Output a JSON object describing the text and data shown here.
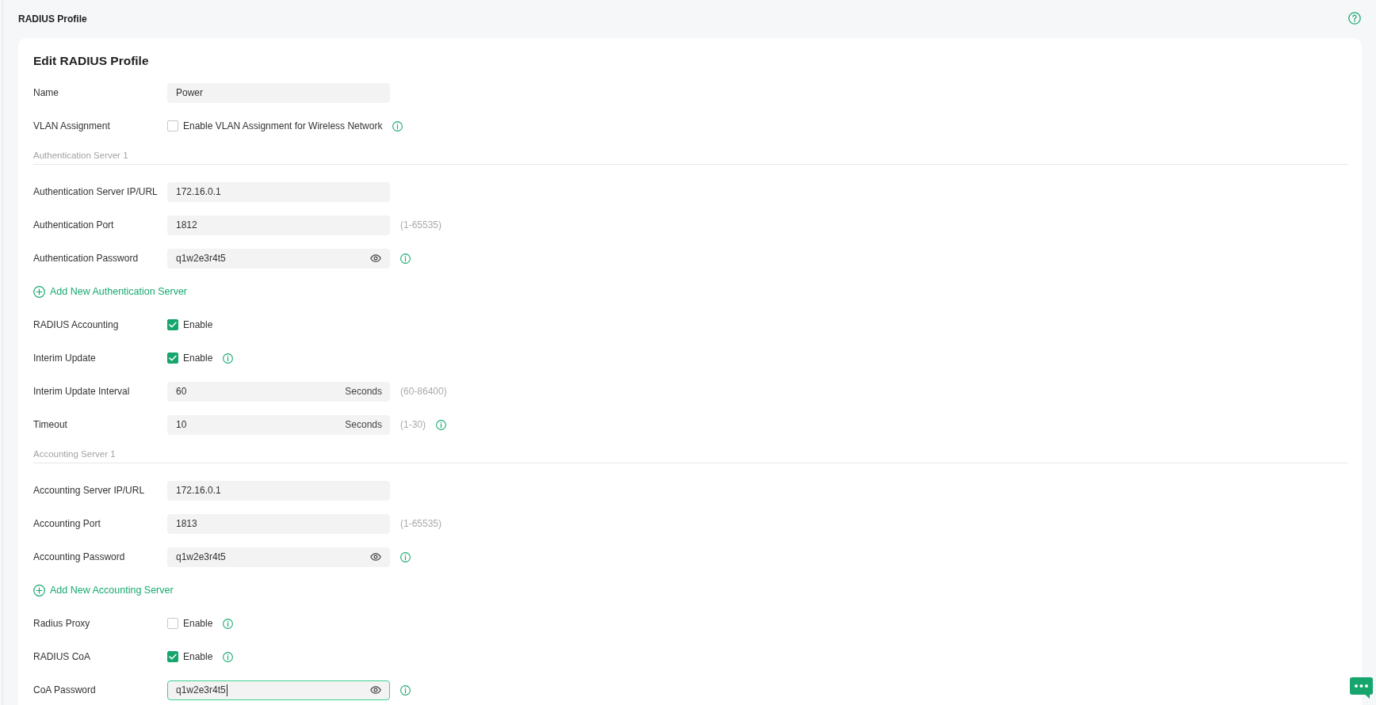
{
  "header": {
    "title": "RADIUS Profile"
  },
  "form": {
    "title": "Edit RADIUS Profile",
    "items": [
      {
        "kind": "field",
        "label": "Name",
        "value": "Power",
        "info": false,
        "focused": false
      },
      {
        "kind": "checkbox",
        "label": "VLAN Assignment",
        "text": "Enable VLAN Assignment for Wireless Network",
        "checked": false,
        "info": true
      },
      {
        "kind": "section",
        "title": "Authentication Server 1"
      },
      {
        "kind": "field",
        "label": "Authentication Server IP/URL",
        "value": "172.16.0.1",
        "info": false,
        "focused": false
      },
      {
        "kind": "field",
        "label": "Authentication Port",
        "value": "1812",
        "hint": "(1-65535)",
        "info": false,
        "focused": false
      },
      {
        "kind": "password",
        "label": "Authentication Password",
        "value": "q1w2e3r4t5",
        "info": true,
        "focused": false
      },
      {
        "kind": "add",
        "text": "Add New Authentication Server"
      },
      {
        "kind": "checkbox",
        "label": "RADIUS Accounting",
        "text": "Enable",
        "checked": true,
        "info": false
      },
      {
        "kind": "checkbox",
        "label": "Interim Update",
        "text": "Enable",
        "checked": true,
        "info": true
      },
      {
        "kind": "field",
        "label": "Interim Update Interval",
        "value": "60",
        "unit": "Seconds",
        "hint": "(60-86400)",
        "info": false,
        "focused": false
      },
      {
        "kind": "field",
        "label": "Timeout",
        "value": "10",
        "unit": "Seconds",
        "hint": "(1-30)",
        "info": true,
        "focused": false
      },
      {
        "kind": "section",
        "title": "Accounting Server 1"
      },
      {
        "kind": "field",
        "label": "Accounting Server IP/URL",
        "value": "172.16.0.1",
        "info": false,
        "focused": false
      },
      {
        "kind": "field",
        "label": "Accounting Port",
        "value": "1813",
        "hint": "(1-65535)",
        "info": false,
        "focused": false
      },
      {
        "kind": "password",
        "label": "Accounting Password",
        "value": "q1w2e3r4t5",
        "info": true,
        "focused": false
      },
      {
        "kind": "add",
        "text": "Add New Accounting Server"
      },
      {
        "kind": "checkbox",
        "label": "Radius Proxy",
        "text": "Enable",
        "checked": false,
        "info": true
      },
      {
        "kind": "checkbox",
        "label": "RADIUS CoA",
        "text": "Enable",
        "checked": true,
        "info": true
      },
      {
        "kind": "password",
        "label": "CoA Password",
        "value": "q1w2e3r4t5",
        "info": true,
        "focused": true
      }
    ]
  }
}
